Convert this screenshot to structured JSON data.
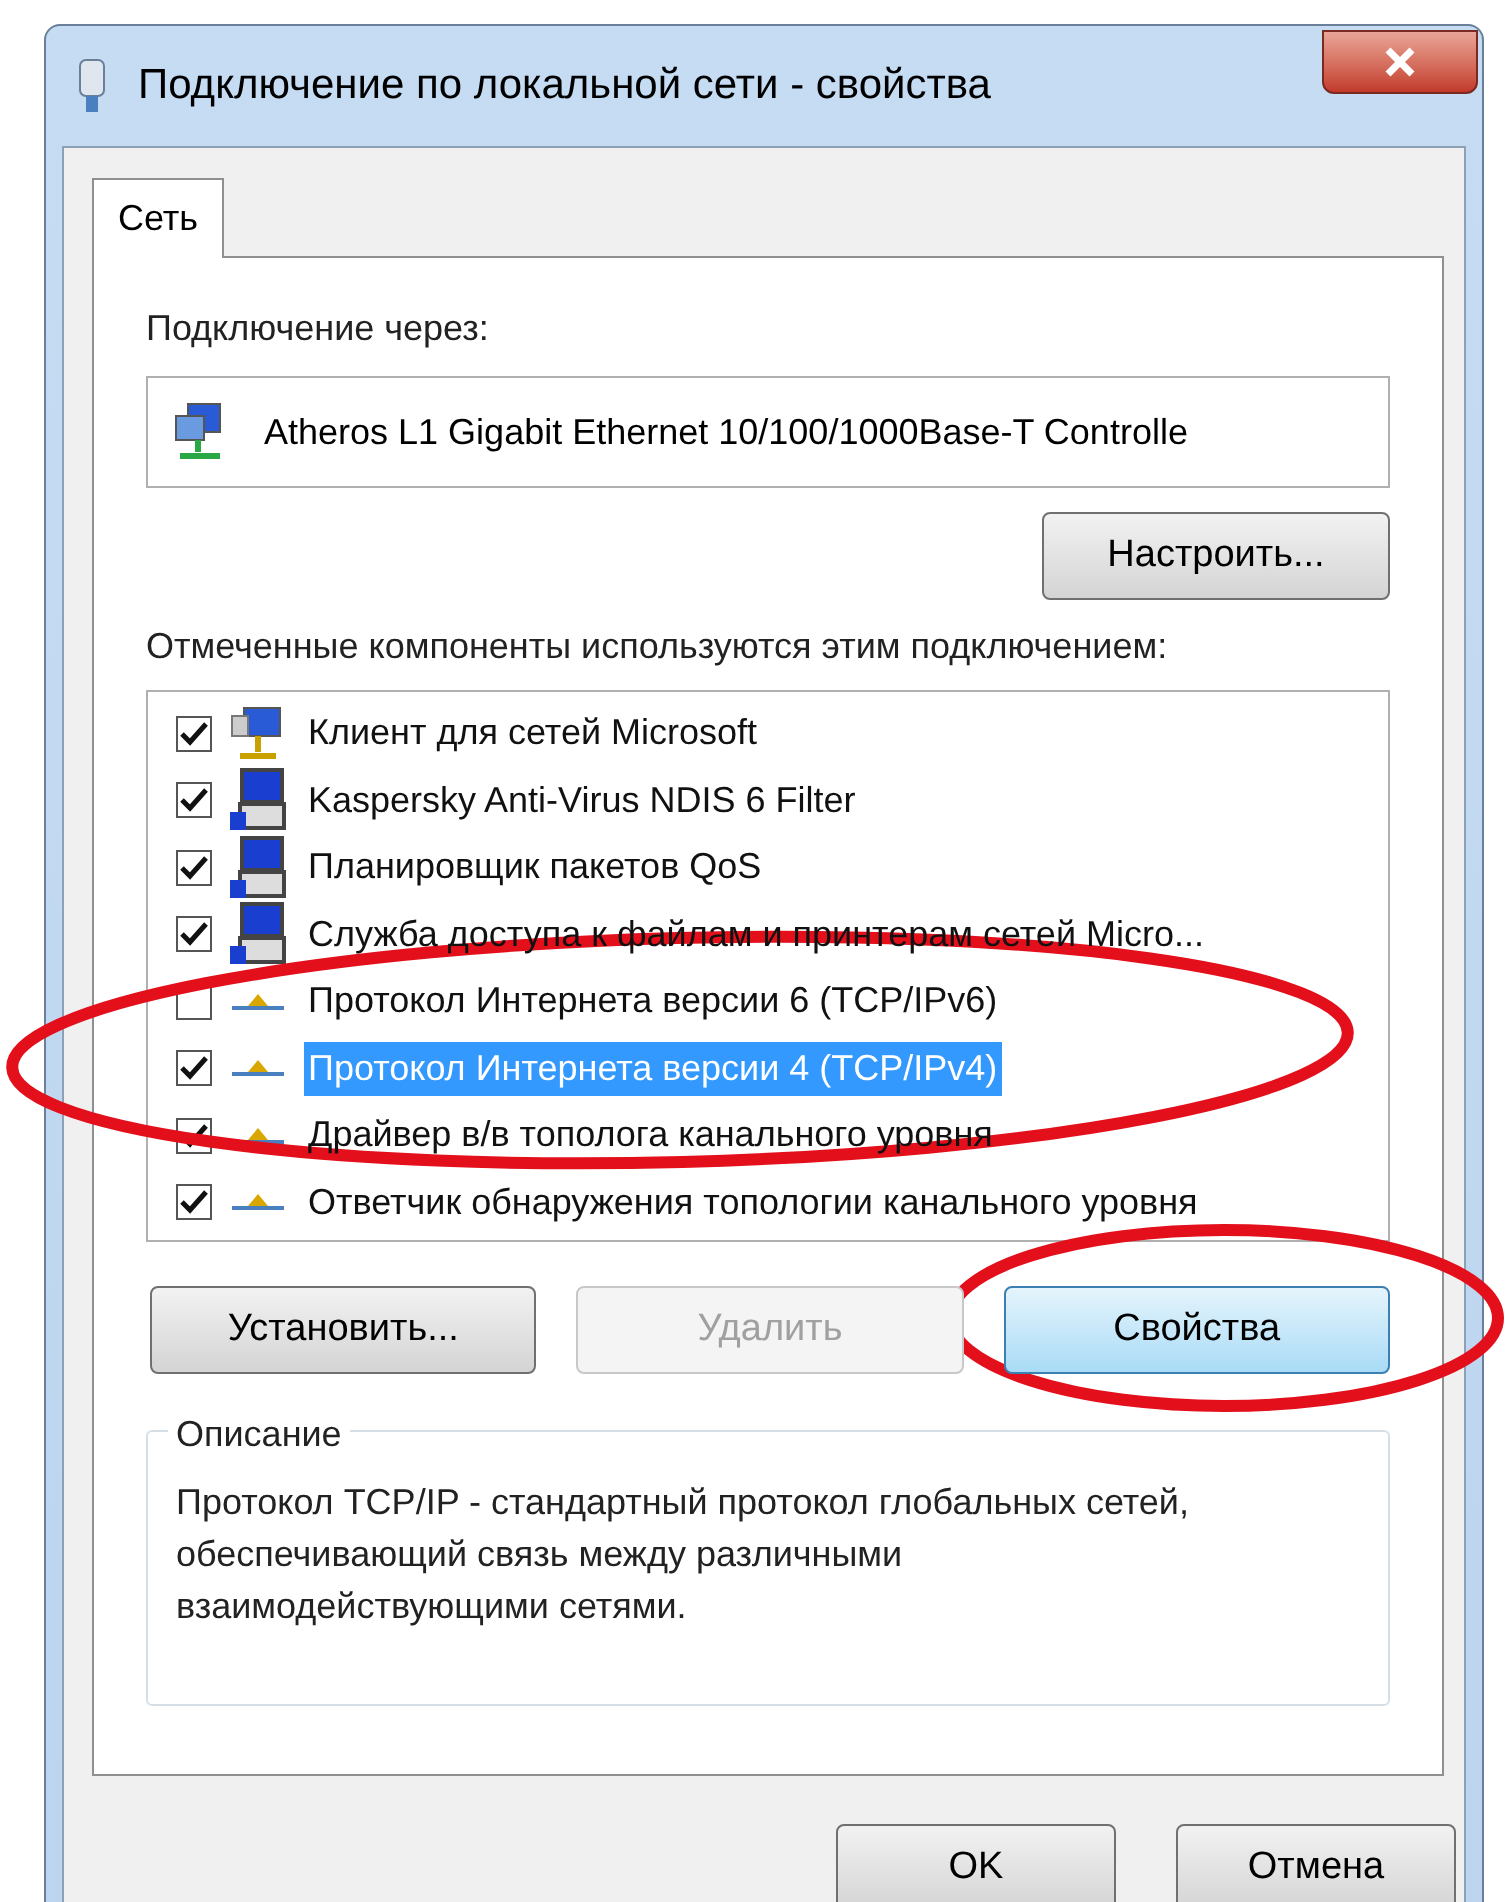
{
  "window": {
    "title": "Подключение по локальной сети - свойства"
  },
  "tabs": [
    {
      "label": "Сеть",
      "selected": true
    }
  ],
  "connect_label": "Подключение через:",
  "adapter": "Atheros L1 Gigabit Ethernet 10/100/1000Base-T Controlle",
  "configure_button": "Настроить...",
  "components_label": "Отмеченные компоненты используются этим подключением:",
  "components": [
    {
      "kind": "client",
      "label": "Клиент для сетей Microsoft",
      "checked": true,
      "selected": false
    },
    {
      "kind": "service",
      "label": "Kaspersky Anti-Virus NDIS 6 Filter",
      "checked": true,
      "selected": false
    },
    {
      "kind": "service",
      "label": "Планировщик пакетов QoS",
      "checked": true,
      "selected": false
    },
    {
      "kind": "service",
      "label": "Служба доступа к файлам и принтерам сетей Micro...",
      "checked": true,
      "selected": false
    },
    {
      "kind": "protocol",
      "label": "Протокол Интернета версии 6 (TCP/IPv6)",
      "checked": false,
      "selected": false
    },
    {
      "kind": "protocol",
      "label": "Протокол Интернета версии 4 (TCP/IPv4)",
      "checked": true,
      "selected": true
    },
    {
      "kind": "protocol",
      "label": "Драйвер в/в тополога канального уровня",
      "checked": true,
      "selected": false
    },
    {
      "kind": "protocol",
      "label": "Ответчик обнаружения топологии канального уровня",
      "checked": true,
      "selected": false
    }
  ],
  "action_buttons": [
    {
      "label": "Установить...",
      "disabled": false,
      "focused": false
    },
    {
      "label": "Удалить",
      "disabled": true,
      "focused": false
    },
    {
      "label": "Свойства",
      "disabled": false,
      "focused": true
    }
  ],
  "description": {
    "title": "Описание",
    "text": "Протокол TCP/IP - стандартный протокол глобальных сетей, обеспечивающий связь между различными взаимодействующими сетями."
  },
  "dialog_buttons": [
    "OK",
    "Отмена"
  ]
}
